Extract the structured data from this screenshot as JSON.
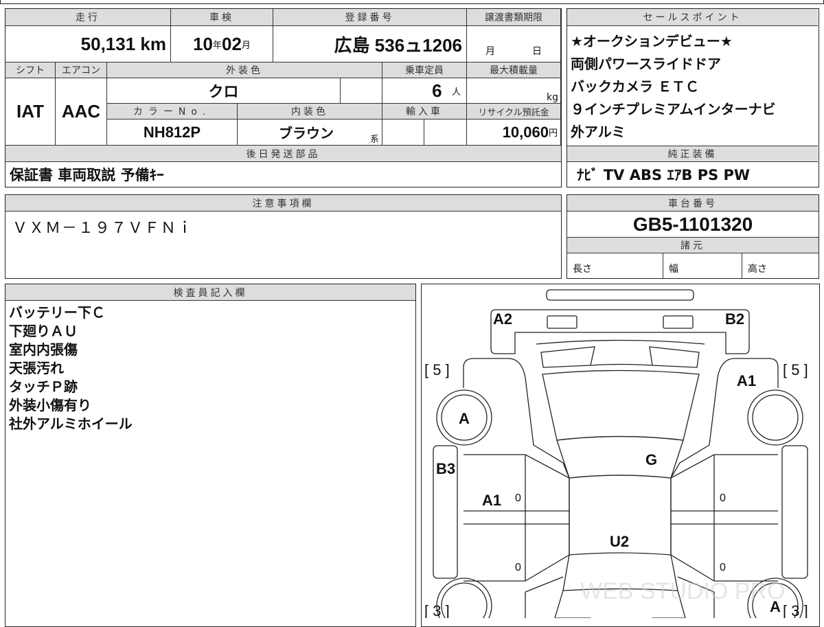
{
  "mileage": {
    "label": "走行",
    "value": "50,131",
    "unit": "km"
  },
  "inspection": {
    "label": "車検",
    "year": "10",
    "year_unit": "年",
    "month": "02",
    "month_unit": "月"
  },
  "registration": {
    "label": "登録番号",
    "value": "広島 536ュ1206"
  },
  "transfer_deadline": {
    "label": "譲渡書類期限",
    "month_unit": "月",
    "day_unit": "日"
  },
  "shift": {
    "label": "シフト",
    "value": "IAT"
  },
  "aircon": {
    "label": "エアコン",
    "value": "AAC"
  },
  "exterior_color": {
    "label": "外装色",
    "value": "クロ"
  },
  "capacity": {
    "label": "乗車定員",
    "value": "6",
    "unit": "人"
  },
  "max_load": {
    "label": "最大積載量",
    "unit": "kg"
  },
  "color_no": {
    "label": "カラーNo.",
    "value": "NH812P"
  },
  "interior_color": {
    "label": "内装色",
    "value": "ブラウン",
    "suffix": "系"
  },
  "imported": {
    "label": "輸入車"
  },
  "recycle_fee": {
    "label": "リサイクル預託金",
    "value": "10,060",
    "unit": "円"
  },
  "later_parts": {
    "label": "後日発送部品",
    "value": "保証書 車両取説 予備ｷｰ"
  },
  "sales_points": {
    "label": "セールスポイント",
    "items": [
      "★オークションデビュー★",
      "両側パワースライドドア",
      "バックカメラ ＥＴＣ",
      "９インチプレミアムインターナビ",
      "外アルミ"
    ]
  },
  "genuine_equipment": {
    "label": "純正装備",
    "value": "ﾅﾋﾞ TV ABS ｴｱB PS PW"
  },
  "notes": {
    "label": "注意事項欄",
    "value": "ＶＸＭ－１９７ＶＦＮｉ"
  },
  "chassis": {
    "label": "車台番号",
    "value": "GB5-1101320"
  },
  "specs": {
    "label": "諸元",
    "length": "長さ",
    "width": "幅",
    "height": "高さ"
  },
  "inspector": {
    "label": "検査員記入欄",
    "items": [
      "バッテリー下Ｃ",
      "下廻りＡＵ",
      "室内内張傷",
      "天張汚れ",
      "タッチＰ跡",
      "外装小傷有り",
      "社外アルミホイール"
    ]
  },
  "diagram": {
    "a2": "A2",
    "b2": "B2",
    "fl_score": "[ 5 ]",
    "fr_score": "[ 5 ]",
    "rl_score": "[ 3 ]",
    "rr_score": "[ 3 ]",
    "right_front_fender": "A1",
    "front_left_wheel": "A",
    "left_sill": "B3",
    "windshield": "G",
    "left_front_door": "A1",
    "roof": "U2",
    "rear_right_wheel": "A",
    "door_marks": [
      "0",
      "0",
      "0",
      "0"
    ],
    "watermark": "WEB STUDIO PRO"
  }
}
